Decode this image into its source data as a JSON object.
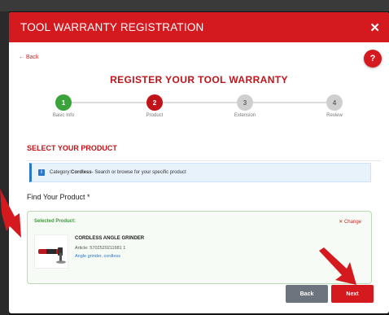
{
  "modal": {
    "title": "TOOL WARRANTY REGISTRATION",
    "close_icon": "✕",
    "back_label": "← Back",
    "help_label": "?"
  },
  "heading": "REGISTER YOUR TOOL WARRANTY",
  "steps": [
    {
      "number": "1",
      "label": "Basic Info",
      "state": "complete",
      "color": "#3aa33a"
    },
    {
      "number": "2",
      "label": "Product",
      "state": "active",
      "color": "#c0141a"
    },
    {
      "number": "3",
      "label": "Extension",
      "state": "pending",
      "color": "#cfcfcf"
    },
    {
      "number": "4",
      "label": "Review",
      "state": "pending",
      "color": "#cfcfcf"
    }
  ],
  "section_title": "SELECT YOUR PRODUCT",
  "info": {
    "icon": "info-icon",
    "prefix": "Category: ",
    "category": "Cordless",
    "suffix": " - Search or browse for your specific product"
  },
  "find_label": "Find Your Product *",
  "selected": {
    "label": "Selected Product:",
    "change_label": "✕ Change",
    "product_name": "CORDLESS ANGLE GRINDER",
    "article": "Article: 5702520211981 1",
    "category_text": "Angle grinder, cordless"
  },
  "buttons": {
    "back": "Back",
    "next": "Next"
  },
  "colors": {
    "brand_red": "#d41a1f",
    "success_green": "#3aa33a",
    "info_blue": "#2a77c9"
  }
}
